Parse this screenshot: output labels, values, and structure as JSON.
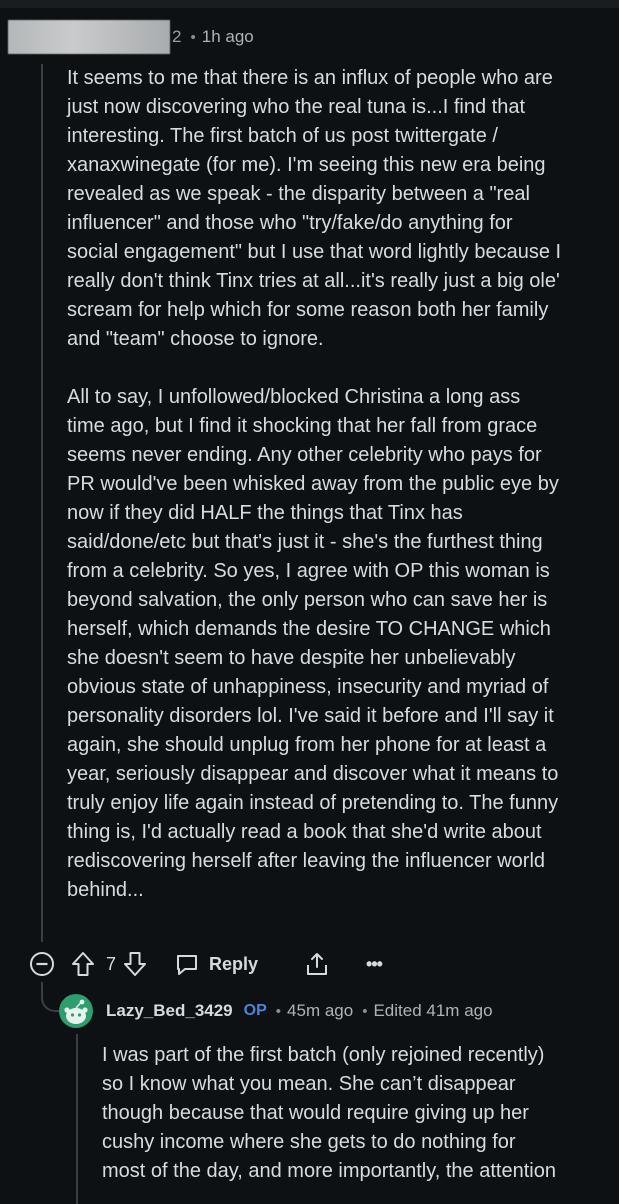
{
  "comment": {
    "author_fragment": "2",
    "separator": "•",
    "time": "1h ago",
    "body": [
      "It seems to me that there is an influx of people who are\njust now discovering who the real tuna is...I find that\ninteresting. The first batch of us post twittergate /\nxanaxwinegate (for me). I'm seeing this new era being\nrevealed as we speak - the disparity between a \"real\ninfluencer\" and those who \"try/fake/do anything for\nsocial engagement\" but I use that word lightly because I\nreally don't think Tinx tries at all...it's really just a big ole'\nscream for help which for some reason both her family\nand \"team\" choose to ignore.",
      "All to say, I unfollowed/blocked Christina a long ass\ntime ago, but I find it shocking that her fall from grace\nseems never ending. Any other celebrity who pays for\nPR would've been whisked away from the public eye by\nnow if they did HALF the things that Tinx has\nsaid/done/etc but that's just it - she's the furthest thing\nfrom a celebrity. So yes, I agree with OP this woman is\nbeyond salvation, the only person who can save her is\nherself, which demands the desire TO CHANGE which\nshe doesn't seem to have despite her unbelievably\nobvious state of unhappiness, insecurity and myriad of\npersonality disorders lol. I've said it before and I'll say it\nagain, she should unplug from her phone for at least a\nyear, seriously disappear and discover what it means to\ntruly enjoy life again instead of pretending to. The funny\nthing is, I'd actually read a book that she'd write about\nrediscovering herself after leaving the influencer world\nbehind..."
    ],
    "actions": {
      "vote_count": "7",
      "reply_label": "Reply",
      "more_label": "•••"
    }
  },
  "reply": {
    "author": "Lazy_Bed_3429",
    "op_badge": "OP",
    "separator": "•",
    "time": "45m ago",
    "edited": "Edited 41m ago",
    "body": "I was part of the first batch (only rejoined recently)\nso I know what you mean. She can’t disappear\nthough because that would require giving up her\ncushy income where she gets to do nothing for\nmost of the day, and more importantly, the attention"
  },
  "colors": {
    "background": "#0e1113",
    "text": "#d9dcde",
    "muted": "#aeb3b7",
    "op_blue": "#4b83d9",
    "avatar_green": "#2e9e6e"
  },
  "icons": {
    "collapse": "minus-circle-icon",
    "upvote": "arrow-up-icon",
    "downvote": "arrow-down-icon",
    "reply": "speech-bubble-icon",
    "share": "share-icon",
    "more": "ellipsis-icon",
    "avatar": "snoo-avatar-icon"
  }
}
